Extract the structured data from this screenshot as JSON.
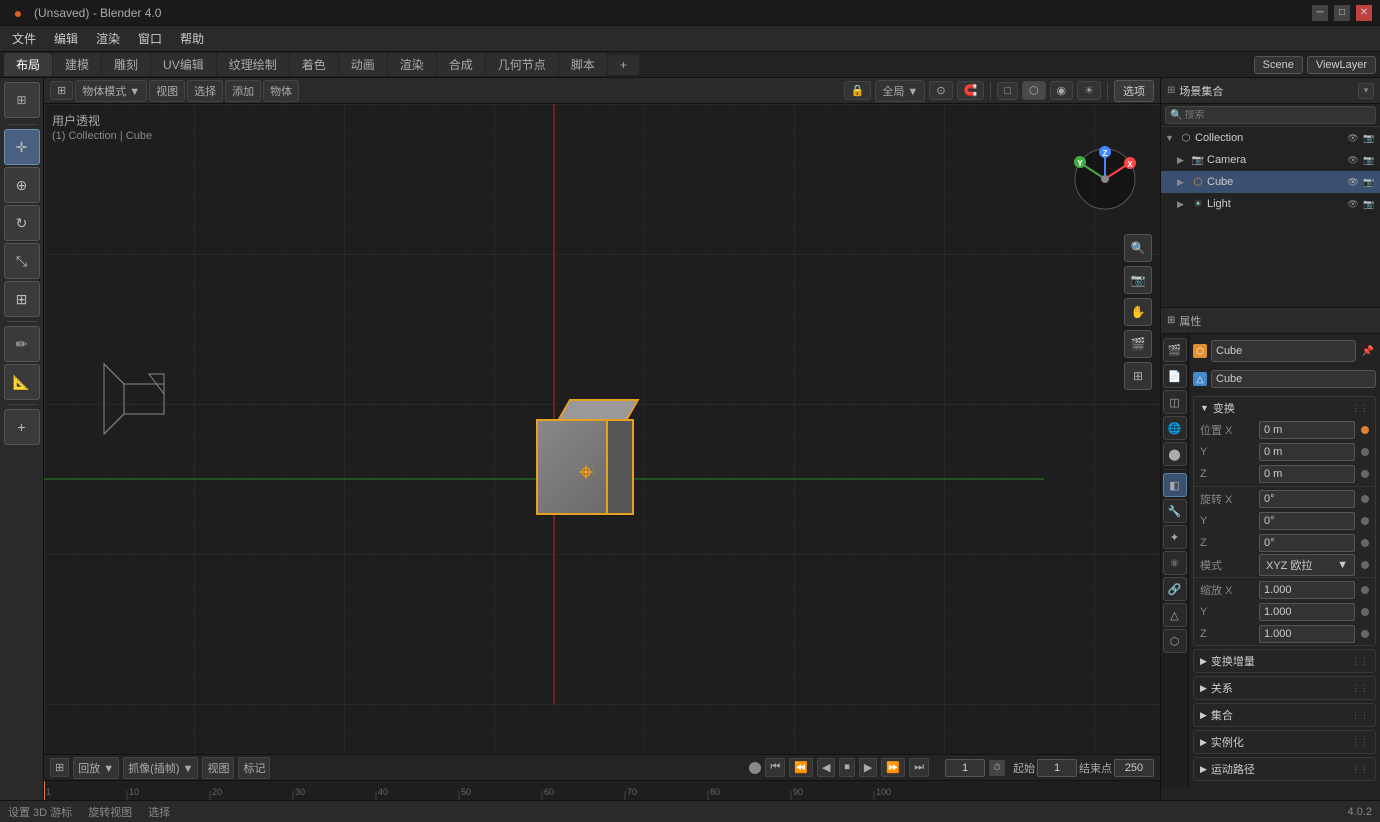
{
  "titlebar": {
    "title": "(Unsaved) - Blender 4.0",
    "blender_version": "4.0.2"
  },
  "menubar": {
    "items": [
      "文件",
      "编辑",
      "渲染",
      "窗口",
      "帮助"
    ]
  },
  "workspacetabs": {
    "tabs": [
      "布局",
      "建模",
      "雕刻",
      "UV编辑",
      "纹理绘制",
      "着色",
      "动画",
      "渲染",
      "合成",
      "几何节点",
      "脚本"
    ],
    "active": "布局",
    "plus_icon": "+",
    "scene_label": "Scene",
    "viewlayer_label": "ViewLayer"
  },
  "viewport": {
    "mode_label": "物体模式",
    "view_label": "用户透视",
    "collection_info": "(1) Collection | Cube",
    "overlay_btn": "选项",
    "global_local": "全局"
  },
  "left_toolbar": {
    "tools": [
      "cursor",
      "move",
      "rotate",
      "scale",
      "transform",
      "annotate",
      "measure",
      "add"
    ]
  },
  "outliner": {
    "title": "场景集合",
    "search_placeholder": "搜索",
    "items": [
      {
        "name": "Collection",
        "type": "collection",
        "indent": 0,
        "expanded": true
      },
      {
        "name": "Camera",
        "type": "camera",
        "indent": 1,
        "expanded": false
      },
      {
        "name": "Cube",
        "type": "mesh",
        "indent": 1,
        "expanded": false,
        "selected": true
      },
      {
        "name": "Light",
        "type": "light",
        "indent": 1,
        "expanded": false
      }
    ]
  },
  "properties": {
    "object_name": "Cube",
    "object_name2": "Cube",
    "sections": {
      "transform": {
        "label": "变换",
        "location": {
          "x": "0 m",
          "y": "0 m",
          "z": "0 m"
        },
        "rotation": {
          "x": "0°",
          "y": "0°",
          "z": "0°",
          "mode": "XYZ 欧拉"
        },
        "scale": {
          "x": "1.000",
          "y": "1.000",
          "z": "1.000"
        }
      },
      "delta_transform": {
        "label": "变换增量"
      },
      "relations": {
        "label": "关系"
      },
      "collection_prop": {
        "label": "集合"
      },
      "instancing": {
        "label": "实例化"
      },
      "motion_path": {
        "label": "运动路径"
      }
    }
  },
  "timeline": {
    "playback_label": "回放",
    "keying_label": "抓像(插帧)",
    "view_label": "视图",
    "markers_label": "标记",
    "current_frame": "1",
    "start_frame": "1",
    "end_frame": "250",
    "fps_label": "起始",
    "fps_end_label": "结束点"
  },
  "statusbar": {
    "shortcut1": "设置 3D 游标",
    "shortcut2": "旋转视图",
    "shortcut3": "选择",
    "version": "4.0.2"
  },
  "icons": {
    "expand_arrow": "▶",
    "collapse_arrow": "▼",
    "menu_dots": "⋮",
    "pin": "📌",
    "eye": "👁",
    "camera_small": "📷",
    "render": "🎬",
    "lock": "🔒",
    "chain": "🔗",
    "dot": "●",
    "search": "🔍"
  }
}
